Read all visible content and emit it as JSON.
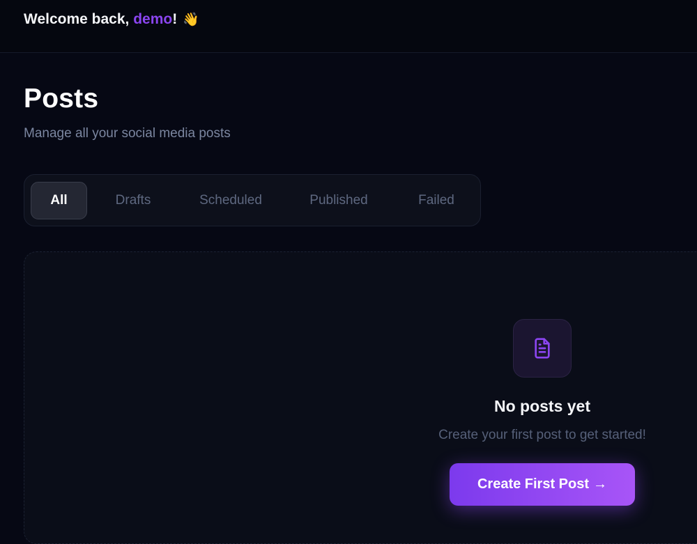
{
  "header": {
    "welcome_prefix": "Welcome back, ",
    "username": "demo",
    "welcome_suffix": "!",
    "wave_emoji": "👋"
  },
  "page": {
    "title": "Posts",
    "subtitle": "Manage all your social media posts"
  },
  "tabs": [
    {
      "label": "All",
      "active": true
    },
    {
      "label": "Drafts",
      "active": false
    },
    {
      "label": "Scheduled",
      "active": false
    },
    {
      "label": "Published",
      "active": false
    },
    {
      "label": "Failed",
      "active": false
    }
  ],
  "empty_state": {
    "icon": "document-icon",
    "title": "No posts yet",
    "text": "Create your first post to get started!",
    "button_label": "Create First Post",
    "button_arrow": "→"
  },
  "colors": {
    "background": "#060814",
    "accent": "#8b45f0",
    "button_gradient_start": "#7c3aed",
    "button_gradient_end": "#a855f7"
  }
}
